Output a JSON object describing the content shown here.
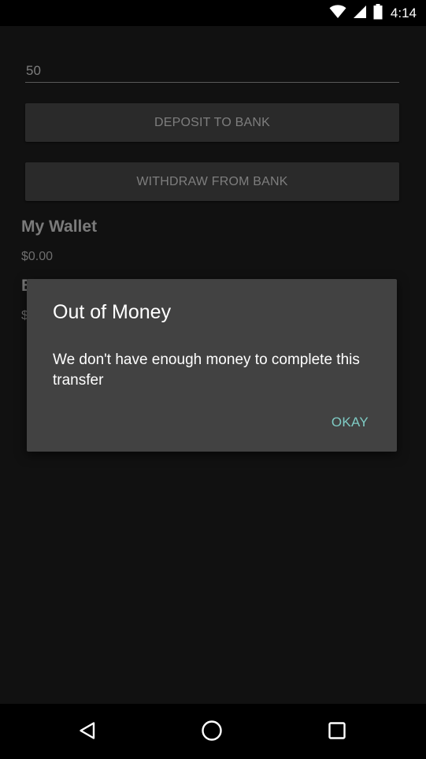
{
  "status_bar": {
    "time": "4:14",
    "icons": [
      "wifi-icon",
      "cellular-signal-icon",
      "battery-icon"
    ]
  },
  "app": {
    "amount_input": {
      "value": "50"
    },
    "deposit_button_label": "DEPOSIT TO BANK",
    "withdraw_button_label": "WITHDRAW FROM BANK",
    "wallet": {
      "title": "My Wallet",
      "value": "$0.00"
    },
    "bank": {
      "title_visible": "B",
      "value_visible": "$"
    }
  },
  "dialog": {
    "title": "Out of Money",
    "message": "We don't have enough money to complete this transfer",
    "okay_label": "OKAY"
  },
  "nav_bar": {
    "icons": [
      "back-icon",
      "home-icon",
      "recent-apps-icon"
    ]
  },
  "colors": {
    "dialog_background": "#424242",
    "accent": "#7fcbc4",
    "app_background": "#111111"
  }
}
